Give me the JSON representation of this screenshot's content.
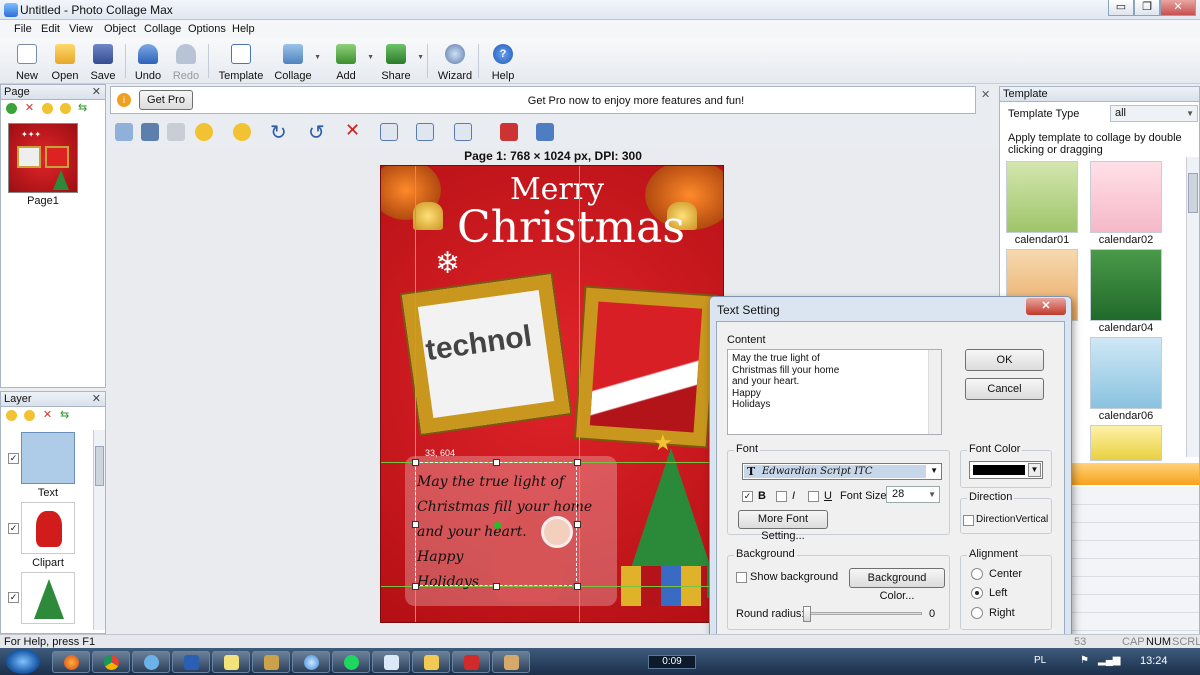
{
  "window": {
    "title": "Untitled - Photo Collage Max",
    "min": "▭",
    "max": "❐",
    "close": "✕"
  },
  "menu": [
    "File",
    "Edit",
    "View",
    "Object",
    "Collage",
    "Options",
    "Help"
  ],
  "toolbar": {
    "new": "New",
    "open": "Open",
    "save": "Save",
    "undo": "Undo",
    "redo": "Redo",
    "template": "Template",
    "collage": "Collage",
    "add": "Add",
    "share": "Share",
    "wizard": "Wizard",
    "help": "Help"
  },
  "page_panel": {
    "title": "Page",
    "page_label": "Page1"
  },
  "layer_panel": {
    "title": "Layer",
    "layers": [
      "Text",
      "Clipart",
      "Clipart"
    ]
  },
  "promo": {
    "button": "Get Pro",
    "message": "Get Pro now to enjoy more features and fun!"
  },
  "canvas": {
    "info": "Page 1: 768 × 1024 px, DPI: 300",
    "card_title_1": "Merry",
    "card_title_2": "Christmas",
    "photo_text": "technol",
    "coords": "33, 604",
    "text_lines": [
      "May the true light of",
      "Christmas fill your home",
      "and your heart.",
      "Happy",
      "Holidays"
    ]
  },
  "template_panel": {
    "title": "Template",
    "type_label": "Template Type",
    "type_value": "all",
    "hint": "Apply template to collage by double clicking or dragging",
    "items": [
      "calendar01",
      "calendar02",
      "calendar04",
      "calendar06"
    ]
  },
  "dialog": {
    "title": "Text Setting",
    "content_label": "Content",
    "content_text": "May the true light of\nChristmas fill your home\nand your heart.\nHappy\nHolidays",
    "ok": "OK",
    "cancel": "Cancel",
    "font_group": "Font",
    "font_name": "Edwardian Script ITC",
    "bold": "B",
    "italic": "I",
    "underline": "U",
    "font_size_label": "Font Size",
    "font_size": "28",
    "more_font": "More Font Setting...",
    "font_color_group": "Font Color",
    "font_color": "#000000",
    "direction_group": "Direction",
    "direction_vertical": "DirectionVertical",
    "background_group": "Background",
    "show_background": "Show background",
    "background_color_btn": "Background Color...",
    "round_radius_label": "Round radius:",
    "round_radius": "0",
    "alignment_group": "Alignment",
    "align_center": "Center",
    "align_left": "Left",
    "align_right": "Right"
  },
  "status": {
    "help": "For Help, press F1",
    "num": "53",
    "cap": "CAP",
    "numlock": "NUM",
    "scrl": "SCRL"
  },
  "taskbar": {
    "media_time": "0:09",
    "lang": "PL",
    "clock": "13:24"
  }
}
